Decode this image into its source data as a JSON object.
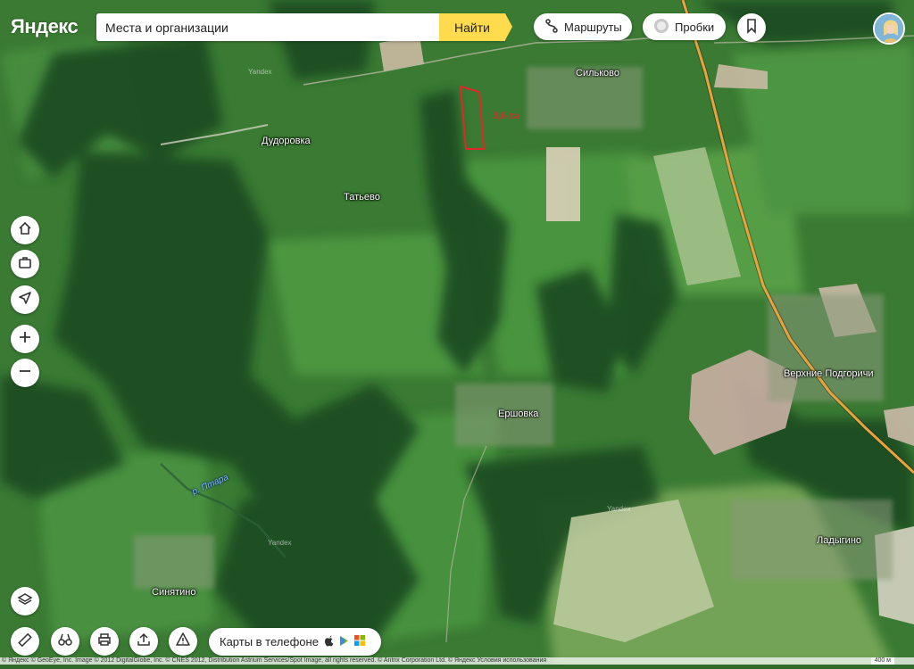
{
  "header": {
    "logo": "Яндекс",
    "search_placeholder": "Места и организации",
    "search_button": "Найти",
    "routes_label": "Маршруты",
    "traffic_label": "Пробки"
  },
  "map": {
    "places": [
      {
        "name": "Силькoво"
      },
      {
        "name": "Дудоровка"
      },
      {
        "name": "Татьево"
      },
      {
        "name": "Ершовка"
      },
      {
        "name": "Верхние Подгоричи"
      },
      {
        "name": "Ладыгино"
      },
      {
        "name": "Синятино"
      }
    ],
    "river_label": "р. Птара",
    "plot_area_label": "3,6 га",
    "watermark": "Yandex"
  },
  "footer": {
    "app_promo_label": "Карты в телефоне",
    "copyright": "© Яндекс  © GeoEye, Inc. Image © 2012 DigitalGlobe, Inc. © CNES 2012, Distribution Astrium Services/Spot Image, all rights reserved. © Antrix Corporation Ltd. © Яндекс Условия использования",
    "scale": "400 м"
  },
  "colors": {
    "accent": "#ffdb4d",
    "road": "#e8a33a",
    "plot_outline": "#e02828"
  }
}
